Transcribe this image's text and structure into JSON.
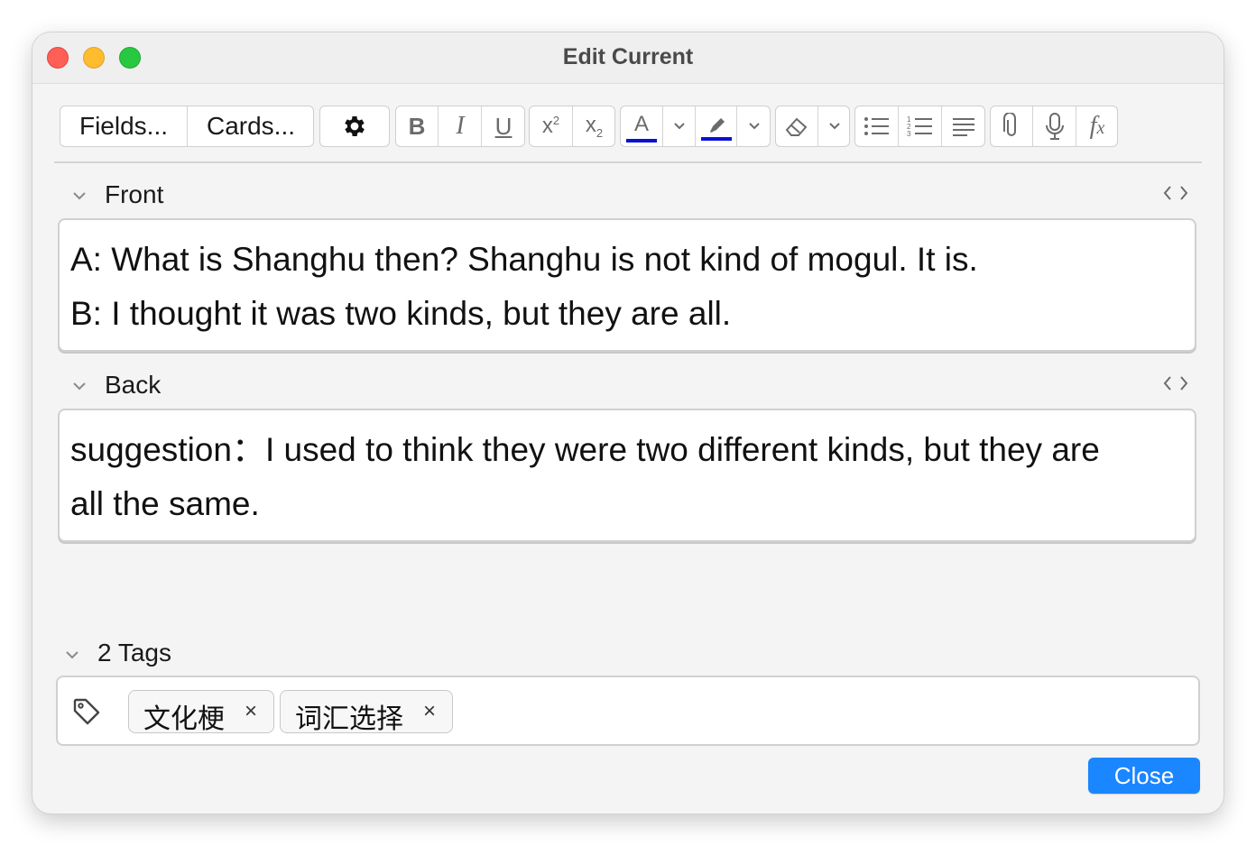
{
  "window": {
    "title": "Edit Current",
    "controls": [
      "close",
      "minimize",
      "zoom"
    ]
  },
  "toolbar": {
    "fields_label": "Fields...",
    "cards_label": "Cards...",
    "buttons": [
      "settings",
      "bold",
      "italic",
      "underline",
      "superscript",
      "subscript",
      "text-color",
      "highlight",
      "clear-formatting",
      "unordered-list",
      "ordered-list",
      "alignment",
      "attach",
      "record-audio",
      "equations"
    ],
    "text_color": "#0a10d6",
    "highlight_color": "#0a10d6"
  },
  "fields": [
    {
      "label": "Front",
      "lines": [
        "A: What is Shanghu then? Shanghu is not kind of mogul. It is.",
        "B: I thought it was two kinds, but they are all."
      ]
    },
    {
      "label": "Back",
      "lines": [
        "suggestion：I used to think they were two different kinds, but they are",
        "all the same."
      ]
    }
  ],
  "tags": {
    "header": "2 Tags",
    "items": [
      "文化梗",
      "词汇选择"
    ],
    "remove_glyph": "×"
  },
  "footer": {
    "close_label": "Close"
  },
  "colors": {
    "accent": "#1a86ff",
    "close_light": "#fe5f57",
    "minimize_light": "#febc2e",
    "zoom_light": "#28c840"
  }
}
